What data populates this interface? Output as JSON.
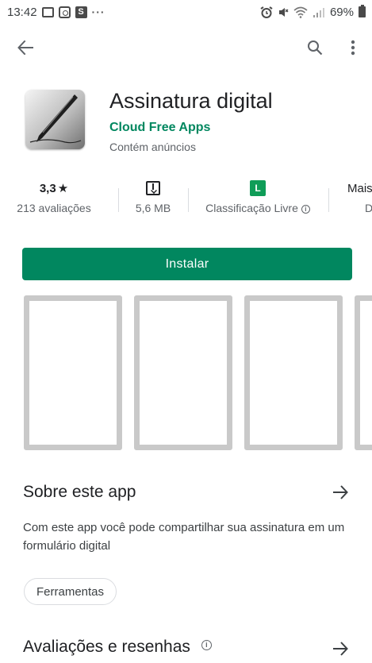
{
  "status_bar": {
    "time": "13:42",
    "more": "···",
    "s_badge": "S",
    "battery_text": "69%"
  },
  "top_bar": {
    "back_icon": "arrow-left-icon",
    "search_icon": "search-icon",
    "more_icon": "more-vert-icon"
  },
  "app": {
    "title": "Assinatura digital",
    "developer": "Cloud Free Apps",
    "ads_notice": "Contém anúncios",
    "icon": "pen-icon"
  },
  "stats": {
    "rating": {
      "value": "3,3",
      "star": "★",
      "label": "213 avaliações"
    },
    "size": {
      "label": "5,6 MB",
      "icon": "download-icon"
    },
    "content_rating": {
      "badge": "L",
      "label": "Classificação Livre",
      "info": "i"
    },
    "more": {
      "top": "Mais",
      "bottom": "D"
    }
  },
  "install_button": {
    "label": "Instalar",
    "color": "#01875f"
  },
  "screenshots": {
    "count": 4,
    "border_color": "#c9c9c9"
  },
  "about": {
    "title": "Sobre este app",
    "description": "Com este app você pode compartilhar sua assinatura em um formulário digital",
    "category_chip": "Ferramentas"
  },
  "reviews": {
    "title": "Avaliações e resenhas",
    "info": "i"
  }
}
